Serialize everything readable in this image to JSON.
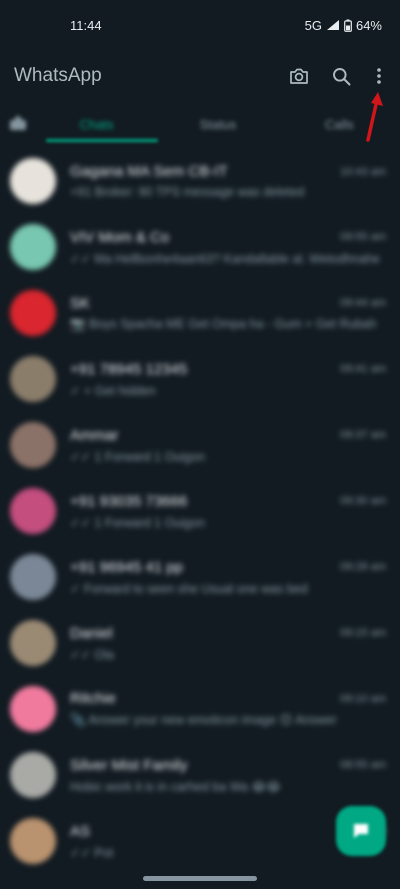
{
  "status_bar": {
    "time": "11:44",
    "network": "5G",
    "battery": "64%"
  },
  "app_bar": {
    "title": "WhatsApp"
  },
  "tabs": [
    {
      "label": "",
      "kind": "communities-icon"
    },
    {
      "label": "Chats",
      "active": true
    },
    {
      "label": "Status"
    },
    {
      "label": "Calls"
    }
  ],
  "chats": [
    {
      "name": "Gagana MA Sem CB-IT",
      "message": "+91 Broker: 90 TPS message was deleted",
      "time": "10:43 am",
      "avatar_color": "#e7e3dc"
    },
    {
      "name": "VIV Mom & Co",
      "message": "✓✓ Ma Hellbonhe4aan63? Kandallable al. Wetodhnahe",
      "time": "09:55 am",
      "avatar_color": "#78c7b0"
    },
    {
      "name": "SK",
      "message": "📷 Boys Spacha ME Get Ompa ha - Gum + Get Rubah",
      "time": "09:44 am",
      "avatar_color": "#d9262f"
    },
    {
      "name": "+91 78945 12345",
      "message": "✓ + Get hidden",
      "time": "09:41 am",
      "avatar_color": "#8a7d6a"
    },
    {
      "name": "Ammar",
      "message": "✓✓ 1 Forward 1 Ouigon",
      "time": "09:37 am",
      "avatar_color": "#8b7268"
    },
    {
      "name": "+91 93035 73666",
      "message": "✓✓ 1 Forward 1 Ouigon",
      "time": "09:30 am",
      "avatar_color": "#c44e7e"
    },
    {
      "name": "+91 96945 41 pp",
      "message": "✓ Forward to seen she Usual one was bed",
      "time": "09:28 am",
      "avatar_color": "#7b8796"
    },
    {
      "name": "Daniel",
      "message": "✓✓ Ola",
      "time": "09:15 am",
      "avatar_color": "#9a8a74"
    },
    {
      "name": "Ritchie",
      "message": "📎 Answer your new emoticon image 😊 Answer",
      "time": "09:10 am",
      "avatar_color": "#f07a9e"
    },
    {
      "name": "Silver Mist Family",
      "message": "Hobic work it is in carhed ba Wa 😂😂",
      "time": "08:55 am",
      "avatar_color": "#a9aaa6"
    },
    {
      "name": "AS",
      "message": "✓✓ Pot",
      "time": "08:40 am",
      "avatar_color": "#b9926f"
    }
  ],
  "colors": {
    "background": "#121b22",
    "accent": "#00a884",
    "secondary_text": "#8696a0",
    "annotation_arrow": "#d0161b"
  },
  "icons": {
    "camera": "camera-icon",
    "search": "search-icon",
    "menu": "more-vertical-icon",
    "new_chat": "new-chat-icon",
    "arrow": "red-arrow-annotation"
  }
}
